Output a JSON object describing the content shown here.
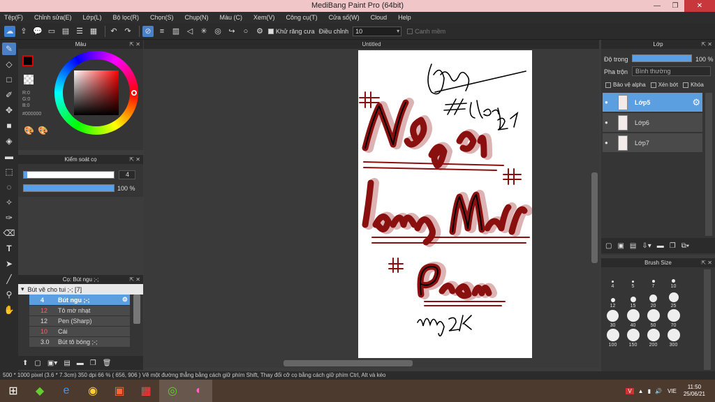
{
  "app": {
    "title": "MediBang Paint Pro (64bit)"
  },
  "menu": [
    "Tệp(F)",
    "Chỉnh sửa(E)",
    "Lớp(L)",
    "Bộ lọc(R)",
    "Chọn(S)",
    "Chụp(N)",
    "Màu (C)",
    "Xem(V)",
    "Công cụ(T)",
    "Cửa số(W)",
    "Cloud",
    "Help"
  ],
  "toolbar": {
    "antialias": "Khử răng cưa",
    "adjust_label": "Điều chỉnh",
    "adjust_value": "10",
    "snap": "Canh mềm"
  },
  "color_panel": {
    "title": "Màu",
    "r": "R:0",
    "g": "G:0",
    "b": "B:0",
    "hex": "#000000"
  },
  "brush_control": {
    "title": "Kiểm soát cọ",
    "size": "4",
    "opacity": "100 %",
    "size_fill": 0.97,
    "opacity_fill": 1.0
  },
  "brush_list": {
    "title": "Cọ: Bút ngu ;-;",
    "group": "Bút vẽ cho tui ;-; [7]",
    "items": [
      {
        "size": "4",
        "name": "Bút ngu ;-;"
      },
      {
        "size": "12",
        "name": "Tô mờ nhạt"
      },
      {
        "size": "12",
        "name": "Pen (Sharp)"
      },
      {
        "size": "10",
        "name": "Cái"
      },
      {
        "size": "3.0",
        "name": "Bút tô bóng ;-;"
      }
    ]
  },
  "canvas": {
    "tab": "Untitled"
  },
  "layer_panel": {
    "title": "Lớp",
    "opacity_label": "Độ trong",
    "opacity": "100 %",
    "blend_label": "Pha trộn",
    "blend": "Bình thường",
    "protect_alpha": "Bảo vệ alpha",
    "clip": "Xén bớt",
    "lock": "Khóa",
    "layers": [
      "Lớp5",
      "Lớp6",
      "Lớp7"
    ]
  },
  "brush_size": {
    "title": "Brush Size",
    "sizes": [
      "4",
      "5",
      "7",
      "10",
      "12",
      "15",
      "20",
      "25",
      "30",
      "40",
      "50",
      "70",
      "100",
      "150",
      "200",
      "300"
    ]
  },
  "status": {
    "text": "500 * 1000 pixel   (3.6 * 7.3cm)   350 dpi   66 %   ( 656, 906 )   Vẽ một đường thẳng bằng cách giữ phím Shift, Thay đổi cỡ cọ bằng cách giữ phím Ctrl, Alt và kéo"
  },
  "tray": {
    "lang": "VIE",
    "time": "11:50",
    "date": "25/06/21"
  }
}
